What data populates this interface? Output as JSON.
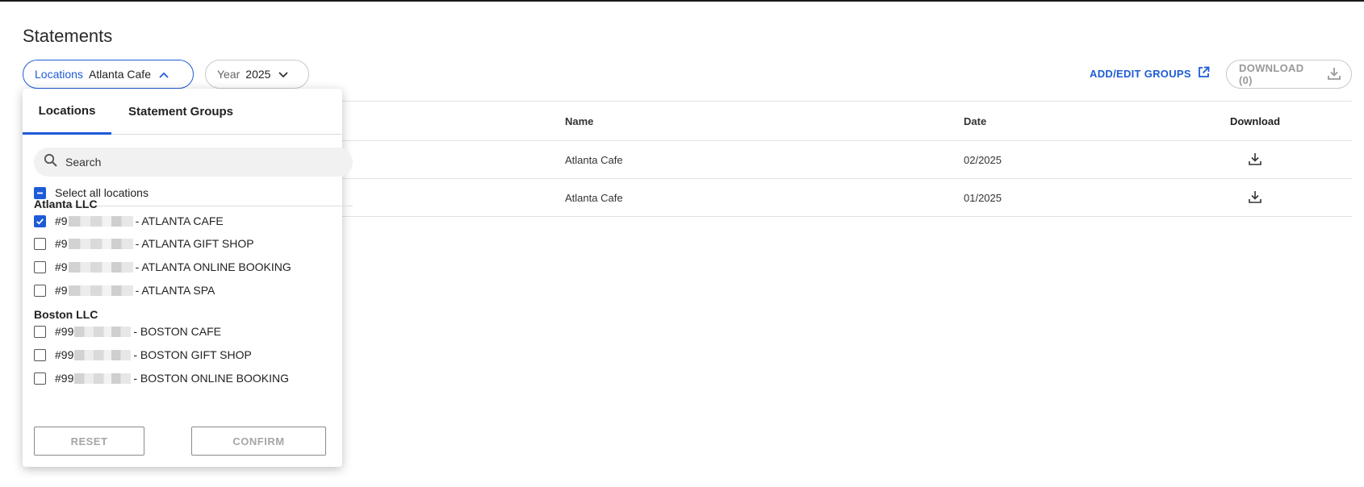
{
  "page": {
    "title": "Statements"
  },
  "filters": {
    "locations": {
      "label": "Locations",
      "value": "Atlanta Cafe"
    },
    "year": {
      "label": "Year",
      "value": "2025"
    }
  },
  "actions": {
    "add_edit_groups": "ADD/EDIT GROUPS",
    "download": "DOWNLOAD (0)"
  },
  "table": {
    "headers": {
      "name": "Name",
      "date": "Date",
      "download": "Download"
    },
    "rows": [
      {
        "name": "Atlanta Cafe",
        "date": "02/2025"
      },
      {
        "name": "Atlanta Cafe",
        "date": "01/2025"
      }
    ]
  },
  "dropdown": {
    "tabs": [
      "Locations",
      "Statement Groups"
    ],
    "search_placeholder": "Search",
    "select_all_label": "Select all locations",
    "groups": [
      {
        "name": "Atlanta LLC",
        "items": [
          {
            "prefix": "#9",
            "label": "- ATLANTA CAFE",
            "checked": true
          },
          {
            "prefix": "#9",
            "label": "- ATLANTA GIFT SHOP",
            "checked": false
          },
          {
            "prefix": "#9",
            "label": "- ATLANTA ONLINE BOOKING",
            "checked": false
          },
          {
            "prefix": "#9",
            "label": "- ATLANTA SPA",
            "checked": false
          }
        ]
      },
      {
        "name": "Boston LLC",
        "items": [
          {
            "prefix": "#99",
            "label": "- BOSTON CAFE",
            "checked": false
          },
          {
            "prefix": "#99",
            "label": "- BOSTON GIFT SHOP",
            "checked": false
          },
          {
            "prefix": "#99",
            "label": "- BOSTON ONLINE BOOKING",
            "checked": false
          }
        ]
      }
    ],
    "reset_label": "RESET",
    "confirm_label": "CONFIRM"
  },
  "colors": {
    "accent": "#1e5bd6",
    "disabled_text": "#a6a6a6",
    "border": "#c9c9c9"
  },
  "icons": {
    "locations_chevron": "chevron-up-icon",
    "year_chevron": "chevron-down-icon",
    "add_edit": "external-link-icon",
    "download": "download-icon",
    "search": "search-icon"
  }
}
